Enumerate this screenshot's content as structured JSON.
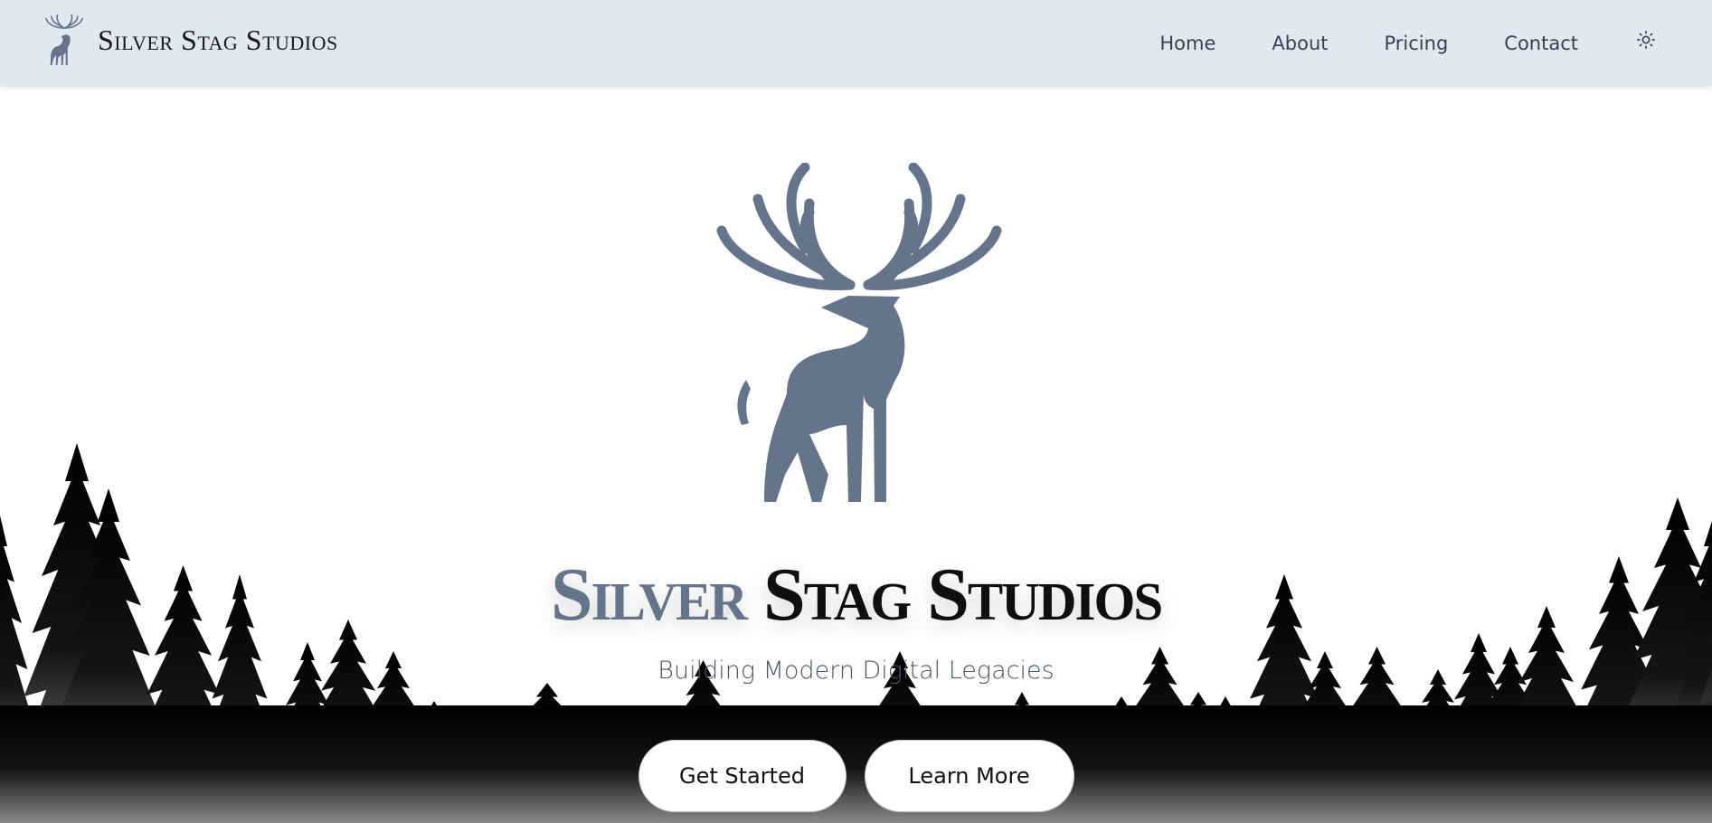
{
  "brand": {
    "name": "Silver Stag Studios",
    "logo_icon": "stag-logo-icon"
  },
  "nav": {
    "items": [
      "Home",
      "About",
      "Pricing",
      "Contact"
    ],
    "theme_icon": "sun-icon"
  },
  "hero": {
    "title_part1": "Silver",
    "title_part2": "Stag Studios",
    "tagline": "Building Modern Digital Legacies",
    "primary_cta": "Get Started",
    "secondary_cta": "Learn More"
  },
  "colors": {
    "nav_background": "#e2e8f0",
    "stag_accent": "#64748b",
    "text_dark": "#0f0f0f",
    "forest": "#000000"
  }
}
